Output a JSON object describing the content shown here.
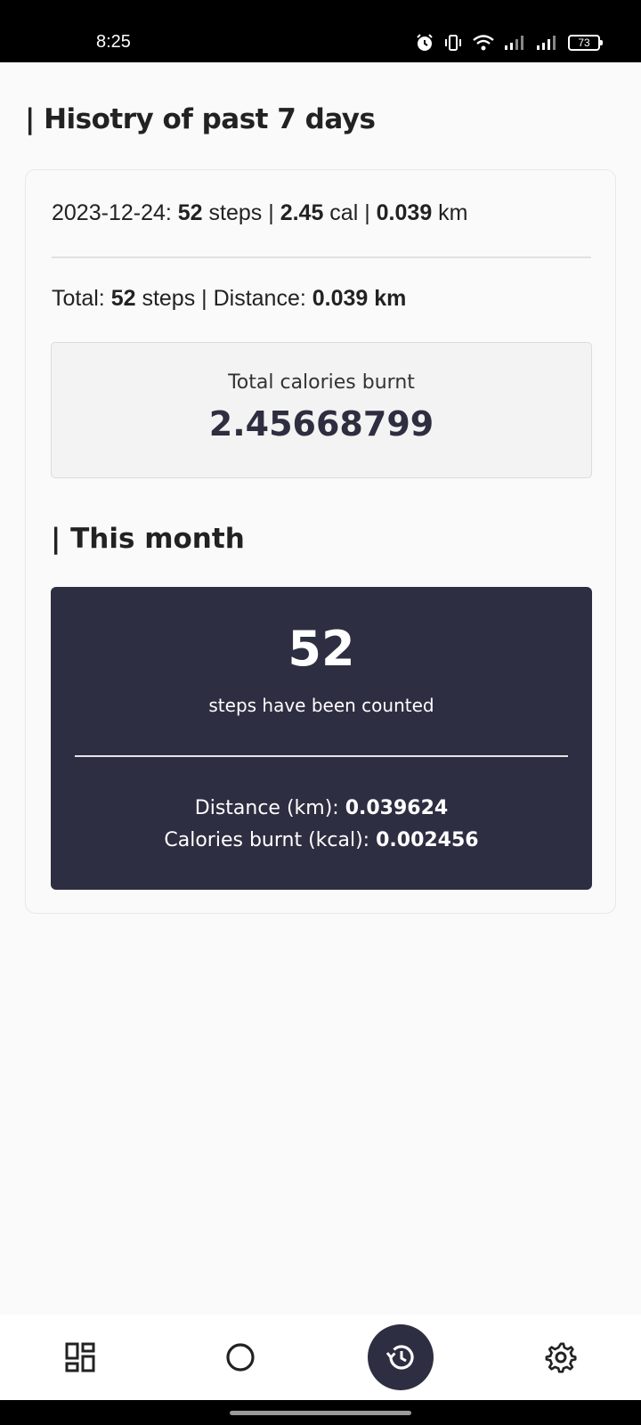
{
  "status_bar": {
    "time": "8:25",
    "battery": "73",
    "icons": [
      "alarm-icon",
      "vibrate-icon",
      "wifi-icon",
      "signal-icon",
      "signal-icon",
      "battery-icon"
    ]
  },
  "history": {
    "title": "| Hisotry of past 7 days",
    "day": {
      "date_prefix": "2023-12-24: ",
      "steps": "52",
      "steps_unit": " steps | ",
      "cal": "2.45",
      "cal_unit": " cal | ",
      "km": "0.039",
      "km_unit": " km"
    },
    "total": {
      "label": "Total: ",
      "steps": "52",
      "steps_unit": " steps | Distance: ",
      "distance": "0.039 km"
    },
    "calories": {
      "label": "Total calories burnt",
      "value": "2.45668799"
    }
  },
  "month": {
    "title": "| This month",
    "steps": "52",
    "steps_label": "steps have been counted",
    "distance_label": "Distance (km): ",
    "distance_value": "0.039624",
    "calories_label": "Calories burnt (kcal): ",
    "calories_value": "0.002456"
  },
  "bottom_nav": {
    "items": [
      "dashboard-icon",
      "circle-icon",
      "history-icon",
      "settings-icon"
    ],
    "active": "history-icon",
    "accent": "#2e2e42"
  }
}
